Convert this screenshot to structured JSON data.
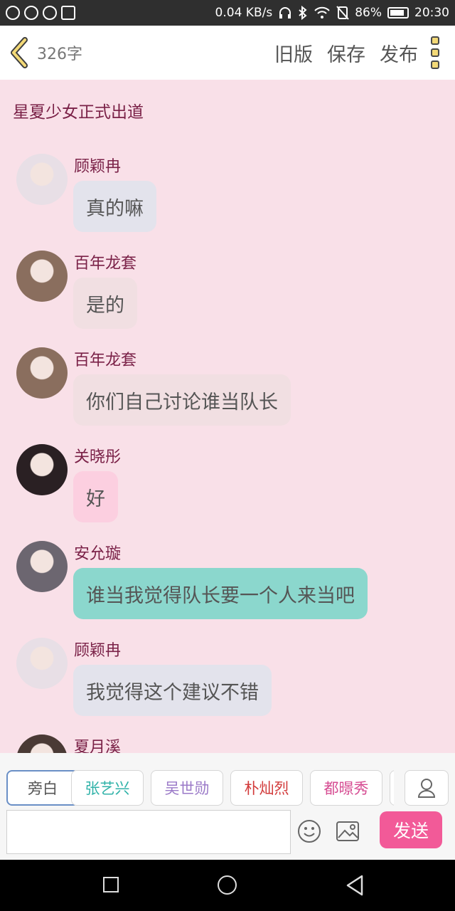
{
  "status_bar": {
    "speed": "0.04 KB/s",
    "battery": "86%",
    "battery_level": 0.86,
    "time": "20:30",
    "left_icons": [
      "weibo-icon",
      "search-icon",
      "message-icon",
      "image-icon"
    ],
    "right_icons": [
      "headphones-icon",
      "bluetooth-icon",
      "wifi-icon",
      "silent-icon",
      "battery-icon"
    ]
  },
  "toolbar": {
    "word_count": "326字",
    "old_version": "旧版",
    "save": "保存",
    "publish": "发布"
  },
  "chat": {
    "title": "星夏少女正式出道",
    "messages": [
      {
        "name": "顾颖冉",
        "text": "真的嘛",
        "bubble_color": "#e3e3ec",
        "avatar_color": "#e8dfe6"
      },
      {
        "name": "百年龙套",
        "text": "是的",
        "bubble_color": "#f1dfe2",
        "avatar_color": "#8a6e5e"
      },
      {
        "name": "百年龙套",
        "text": "你们自己讨论谁当队长",
        "bubble_color": "#f1dfe2",
        "avatar_color": "#8a6e5e"
      },
      {
        "name": "关晓彤",
        "text": "好",
        "bubble_color": "#fccfe0",
        "avatar_color": "#2a2023"
      },
      {
        "name": "安允璇",
        "text": "谁当我觉得队长要一个人来当吧",
        "bubble_color": "#8bd7cd",
        "avatar_color": "#6c6670"
      },
      {
        "name": "顾颖冉",
        "text": "我觉得这个建议不错",
        "bubble_color": "#e3e3ec",
        "avatar_color": "#e8dfe6"
      },
      {
        "name": "夏月溪",
        "text": "",
        "bubble_color": "#e3e3ec",
        "avatar_color": "#4a3a35"
      }
    ]
  },
  "characters": [
    {
      "label": "旁白",
      "color": "#555555",
      "active": true
    },
    {
      "label": "张艺兴",
      "color": "#2fb2a8",
      "active": false
    },
    {
      "label": "吴世勋",
      "color": "#9b7ac8",
      "active": false
    },
    {
      "label": "朴灿烈",
      "color": "#d23b3b",
      "active": false
    },
    {
      "label": "都暻秀",
      "color": "#d64c92",
      "active": false
    }
  ],
  "composer": {
    "placeholder": "",
    "send": "发送"
  }
}
